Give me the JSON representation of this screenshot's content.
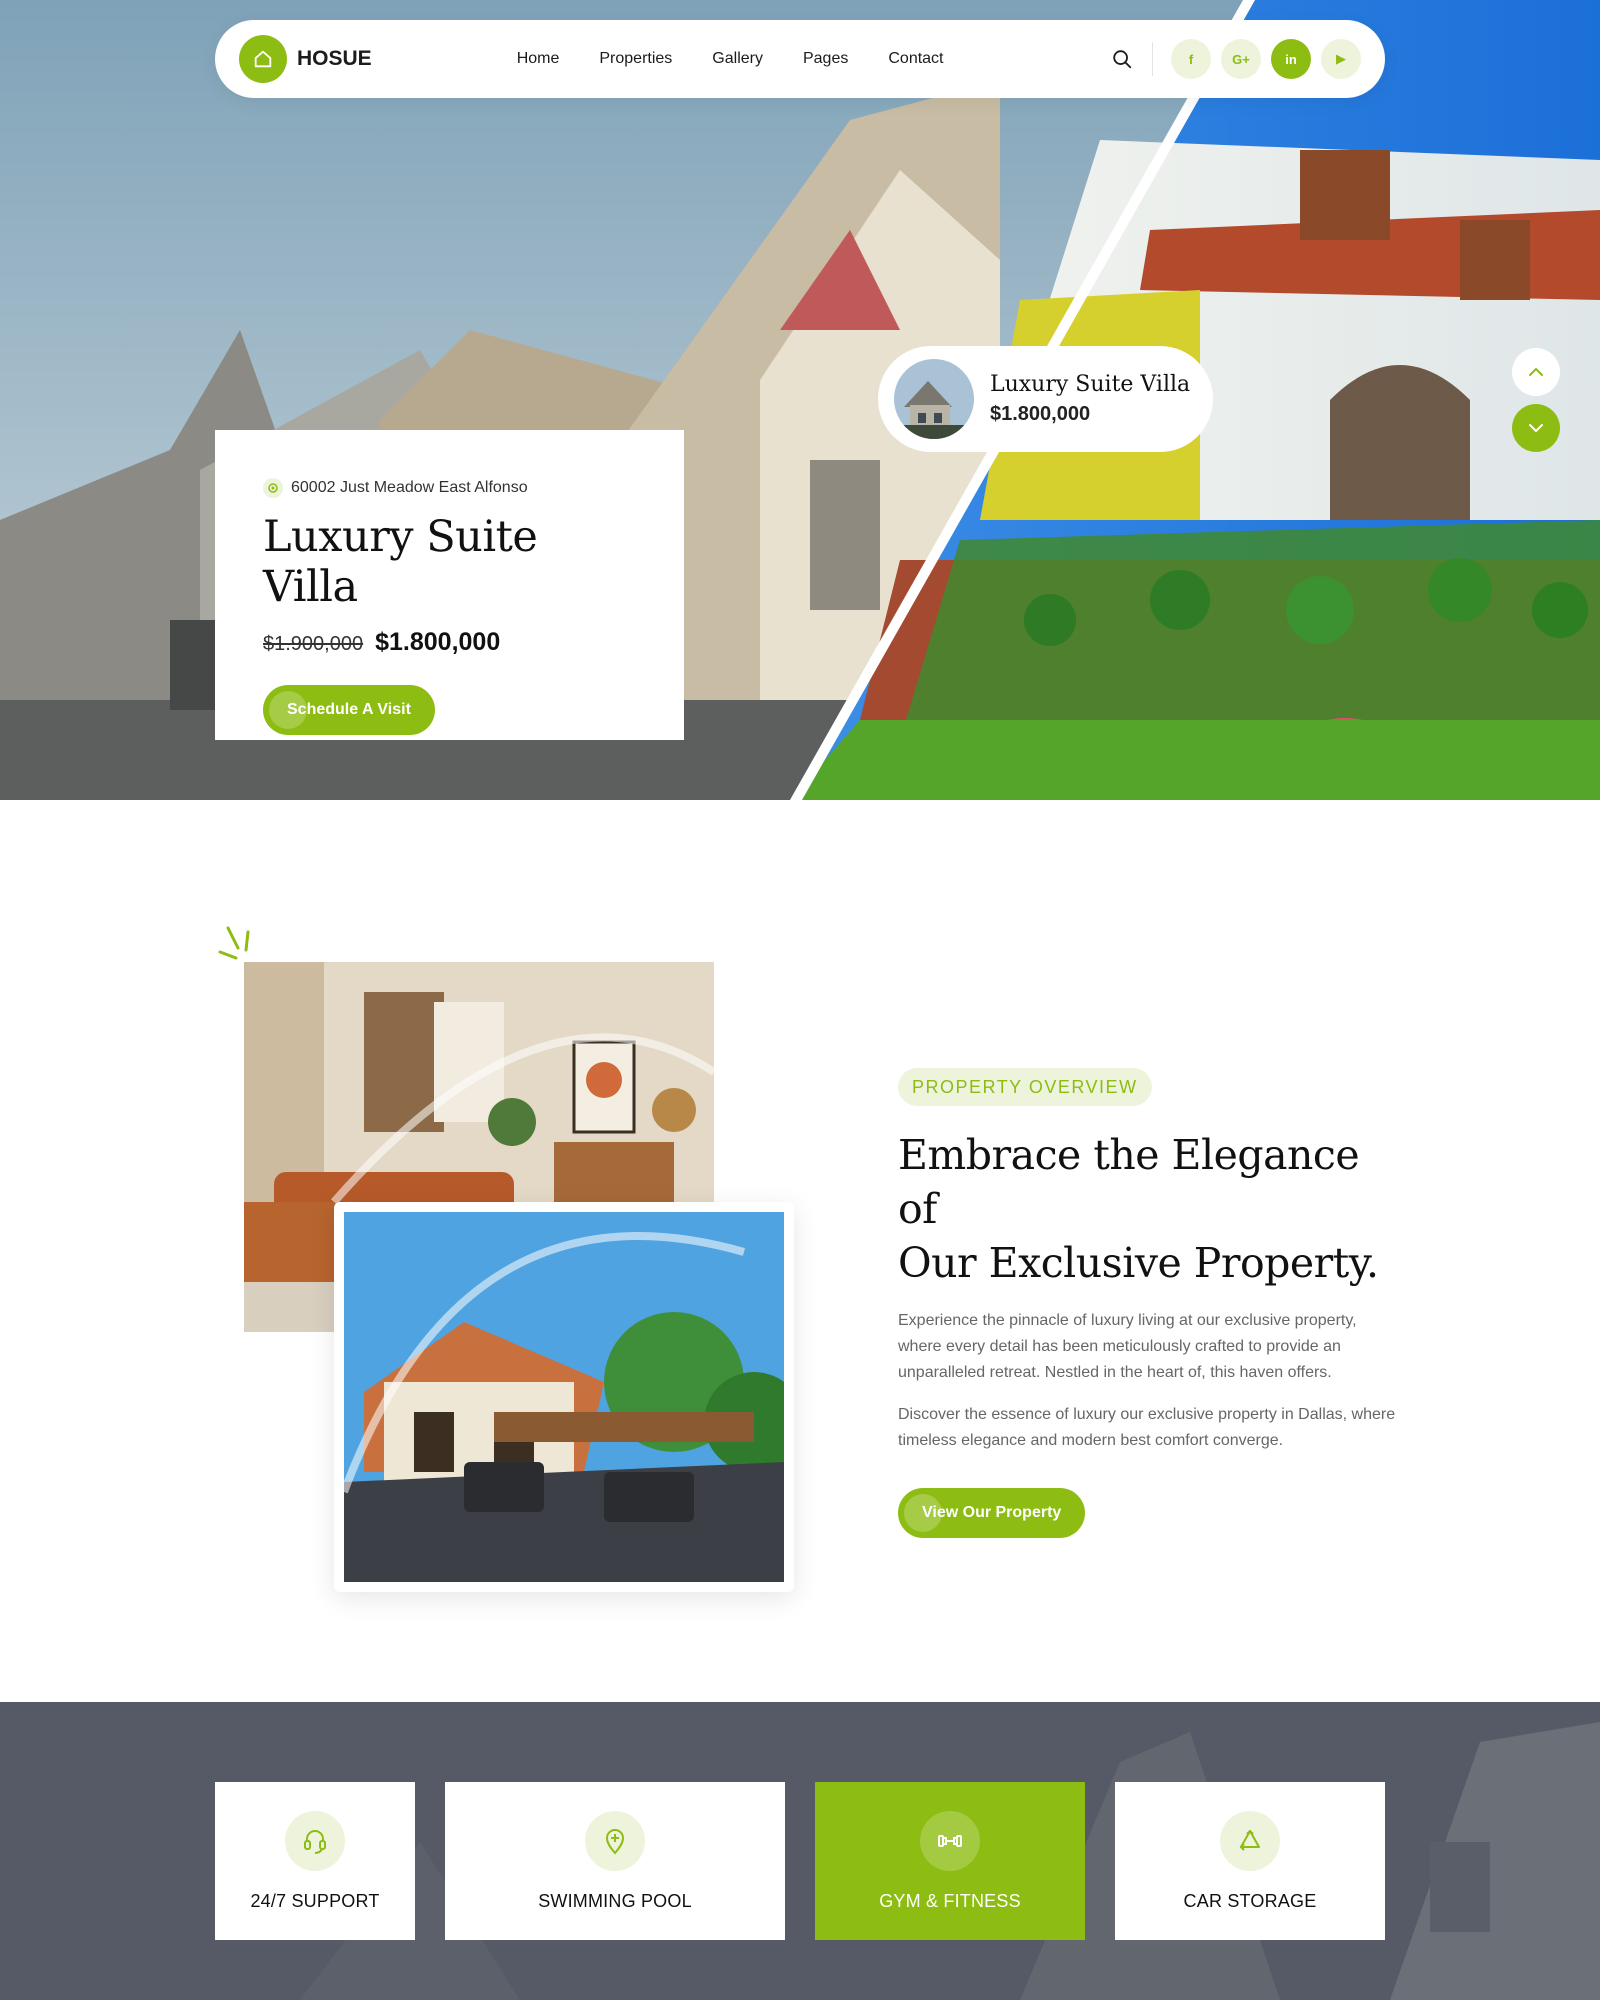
{
  "brand": {
    "name": "HOSUE",
    "accent": "#8dbd12",
    "accent_light": "#eef3dc"
  },
  "nav": {
    "links": [
      "Home",
      "Properties",
      "Gallery",
      "Pages",
      "Contact"
    ],
    "search_icon": "search-icon",
    "social": [
      {
        "label": "f",
        "icon": "facebook-icon"
      },
      {
        "label": "G+",
        "icon": "google-plus-icon"
      },
      {
        "label": "in",
        "icon": "linkedin-icon"
      },
      {
        "label": "▶",
        "icon": "youtube-icon"
      }
    ]
  },
  "hero": {
    "address": "60002 Just Meadow East Alfonso",
    "title": "Luxury Suite Villa",
    "old_price": "$1.900,000",
    "price": "$1.800,000",
    "cta": "Schedule A Visit",
    "bubble": {
      "title": "Luxury Suite Villa",
      "price": "$1.800,000"
    }
  },
  "overview": {
    "badge": "PROPERTY OVERVIEW",
    "title_line1": "Embrace the Elegance of",
    "title_line2": "Our Exclusive Property.",
    "paragraph1": "Experience the pinnacle of luxury living at our exclusive property, where every detail has been meticulously crafted to provide an unparalleled retreat. Nestled in the heart of, this haven offers.",
    "paragraph2": "Discover the essence of luxury  our exclusive property in Dallas, where timeless elegance and modern best comfort converge.",
    "cta": "View Our Property"
  },
  "features": [
    {
      "label": "24/7 SUPPORT",
      "icon": "headset-icon"
    },
    {
      "label": "SWIMMING POOL",
      "icon": "pool-pin-icon"
    },
    {
      "label": "GYM & FITNESS",
      "icon": "dumbbell-icon"
    },
    {
      "label": "CAR STORAGE",
      "icon": "recycle-icon"
    }
  ]
}
